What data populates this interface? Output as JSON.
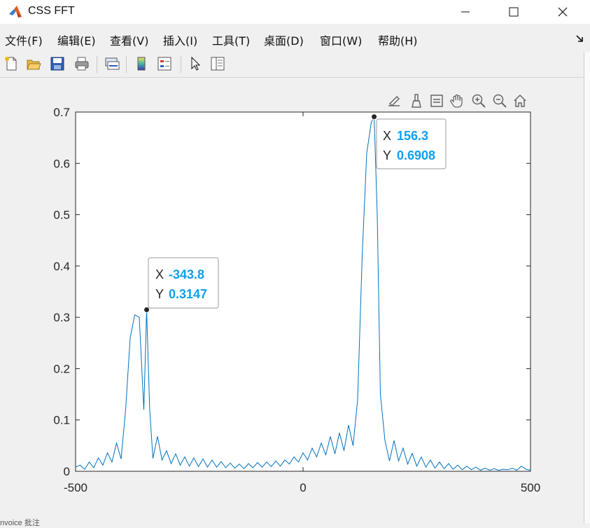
{
  "window": {
    "title": "CSS FFT",
    "icon": "matlab-logo-icon",
    "controls": [
      "minimize-icon",
      "maximize-icon",
      "close-icon"
    ]
  },
  "menubar": {
    "items": [
      {
        "label": "文件(F)"
      },
      {
        "label": "编辑(E)"
      },
      {
        "label": "查看(V)"
      },
      {
        "label": "插入(I)"
      },
      {
        "label": "工具(T)"
      },
      {
        "label": "桌面(D)"
      },
      {
        "label": "窗口(W)"
      },
      {
        "label": "帮助(H)"
      }
    ]
  },
  "toolbar": {
    "buttons": [
      "new-figure-icon",
      "open-file-icon",
      "save-icon",
      "print-icon",
      "link-plot-icon",
      "insert-colorbar-icon",
      "insert-legend-icon",
      "edit-plot-arrow-icon",
      "property-inspector-icon"
    ]
  },
  "axes_toolbar": {
    "buttons": [
      "export-icon",
      "brush-icon",
      "data-tips-icon",
      "pan-hand-icon",
      "zoom-in-icon",
      "zoom-out-icon",
      "restore-view-home-icon"
    ]
  },
  "datatips": [
    {
      "x_label": "X",
      "x_value": "156.3",
      "y_label": "Y",
      "y_value": "0.6908"
    },
    {
      "x_label": "X",
      "x_value": "-343.8",
      "y_label": "Y",
      "y_value": "0.3147"
    }
  ],
  "footer": {
    "text": "nvoice 批注"
  },
  "colors": {
    "line": "#0072bd",
    "datatip_value": "#0e9ff0",
    "axes": "#262626"
  },
  "chart_data": {
    "type": "line",
    "xlim": [
      -500,
      500
    ],
    "ylim": [
      0,
      0.7
    ],
    "x_ticks": [
      -500,
      0,
      500
    ],
    "x_tick_labels": [
      "-500",
      "0",
      "500"
    ],
    "y_ticks": [
      0,
      0.1,
      0.2,
      0.3,
      0.4,
      0.5,
      0.6,
      0.7
    ],
    "y_tick_labels": [
      "0",
      "0.1",
      "0.2",
      "0.3",
      "0.4",
      "0.5",
      "0.6",
      "0.7"
    ],
    "grid": false,
    "series": [
      {
        "x": [
          -500,
          -490,
          -480,
          -470,
          -460,
          -450,
          -440,
          -430,
          -420,
          -410,
          -400,
          -390,
          -380,
          -370,
          -360,
          -350,
          -343.8,
          -337,
          -330,
          -320,
          -310,
          -300,
          -290,
          -280,
          -270,
          -260,
          -250,
          -240,
          -230,
          -220,
          -210,
          -200,
          -190,
          -180,
          -170,
          -160,
          -150,
          -140,
          -130,
          -120,
          -110,
          -100,
          -90,
          -80,
          -70,
          -60,
          -50,
          -40,
          -30,
          -20,
          -10,
          0,
          10,
          20,
          30,
          40,
          50,
          60,
          70,
          80,
          90,
          100,
          110,
          120,
          130,
          140,
          150,
          156.3,
          163,
          170,
          180,
          190,
          200,
          210,
          220,
          230,
          240,
          250,
          260,
          270,
          280,
          290,
          300,
          310,
          320,
          330,
          340,
          350,
          360,
          370,
          380,
          390,
          400,
          410,
          420,
          430,
          440,
          450,
          460,
          470,
          480,
          490,
          500
        ],
        "y": [
          0.008,
          0.012,
          0.004,
          0.018,
          0.007,
          0.026,
          0.012,
          0.036,
          0.018,
          0.055,
          0.024,
          0.12,
          0.26,
          0.305,
          0.3,
          0.12,
          0.3147,
          0.12,
          0.025,
          0.068,
          0.022,
          0.04,
          0.015,
          0.034,
          0.012,
          0.028,
          0.01,
          0.026,
          0.009,
          0.024,
          0.008,
          0.022,
          0.008,
          0.019,
          0.007,
          0.016,
          0.006,
          0.014,
          0.005,
          0.015,
          0.007,
          0.017,
          0.008,
          0.018,
          0.009,
          0.02,
          0.01,
          0.022,
          0.014,
          0.028,
          0.018,
          0.036,
          0.022,
          0.045,
          0.028,
          0.055,
          0.032,
          0.068,
          0.034,
          0.075,
          0.04,
          0.09,
          0.05,
          0.14,
          0.42,
          0.62,
          0.68,
          0.6908,
          0.5,
          0.15,
          0.06,
          0.02,
          0.06,
          0.02,
          0.045,
          0.014,
          0.035,
          0.01,
          0.028,
          0.008,
          0.022,
          0.006,
          0.018,
          0.005,
          0.015,
          0.004,
          0.012,
          0.003,
          0.01,
          0.003,
          0.008,
          0.002,
          0.006,
          0.002,
          0.005,
          0.002,
          0.004,
          0.003,
          0.006,
          0.002,
          0.01,
          0.004,
          0.002
        ]
      }
    ],
    "markers": [
      {
        "x": 156.3,
        "y": 0.6908
      },
      {
        "x": -343.8,
        "y": 0.3147
      }
    ]
  }
}
